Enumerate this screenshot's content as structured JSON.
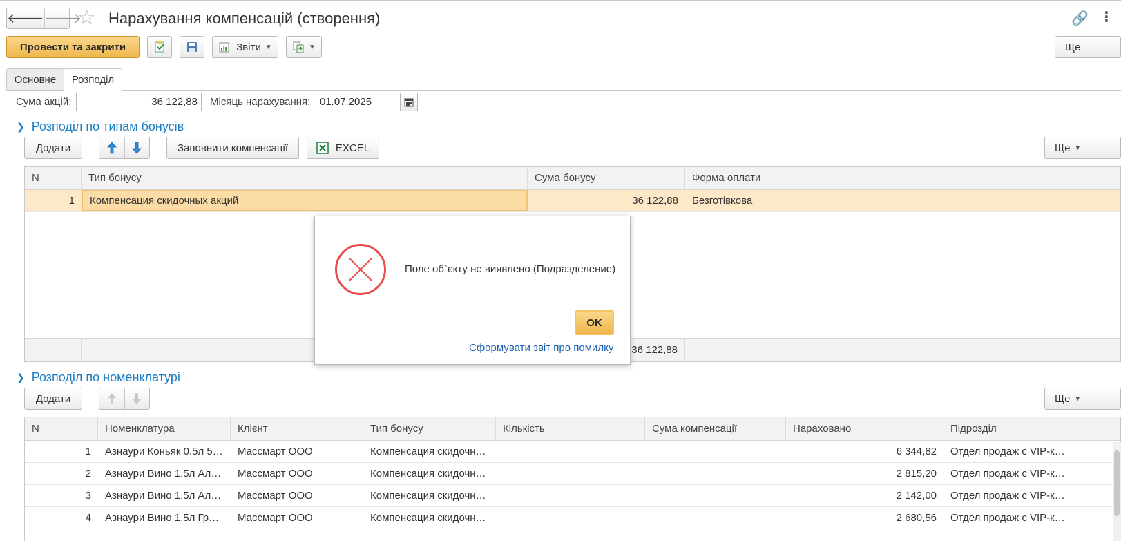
{
  "window": {
    "title": "Нарахування компенсацій (створення)"
  },
  "toolbar": {
    "post_close_label": "Провести та закрити",
    "reports_label": "Звіти",
    "more_label": "Ще"
  },
  "tabs": [
    {
      "label": "Основне",
      "active": false
    },
    {
      "label": "Розподіл",
      "active": true
    }
  ],
  "header_fields": {
    "sum_label": "Сума акцій:",
    "sum_value": "36 122,88",
    "month_label": "Місяць нарахування:",
    "month_value": "01.07.2025"
  },
  "bonus_section": {
    "title": "Розподіл по типам бонусів",
    "add_label": "Додати",
    "fill_label": "Заповнити компенсації",
    "excel_label": "EXCEL",
    "more_label": "Ще",
    "columns": [
      "N",
      "Тип бонусу",
      "Сума бонусу",
      "Форма оплати"
    ],
    "rows": [
      {
        "n": "1",
        "type": "Компенсация скидочных акций",
        "sum": "36 122,88",
        "payment": "Безготівкова"
      }
    ],
    "total_sum": "36 122,88"
  },
  "nomenclature_section": {
    "title": "Розподіл по номенклатурі",
    "add_label": "Додати",
    "more_label": "Ще",
    "columns": [
      "N",
      "Номенклатура",
      "Клієнт",
      "Тип бонусу",
      "Кількість",
      "Сума компенсації",
      "Нараховано",
      "Підрозділ"
    ],
    "rows": [
      {
        "n": "1",
        "item": "Азнаури Коньяк 0.5л 5…",
        "client": "Массмарт ООО",
        "type": "Компенсация скидочн…",
        "qty": "",
        "comp": "",
        "accrued": "6 344,82",
        "dept": "Отдел продаж с  VIP-к…"
      },
      {
        "n": "2",
        "item": "Азнаури Вино 1.5л Ал…",
        "client": "Массмарт ООО",
        "type": "Компенсация скидочн…",
        "qty": "",
        "comp": "",
        "accrued": "2 815,20",
        "dept": "Отдел продаж с  VIP-к…"
      },
      {
        "n": "3",
        "item": "Азнаури Вино 1.5л Ал…",
        "client": "Массмарт ООО",
        "type": "Компенсация скидочн…",
        "qty": "",
        "comp": "",
        "accrued": "2 142,00",
        "dept": "Отдел продаж с  VIP-к…"
      },
      {
        "n": "4",
        "item": "Азнаури Вино 1.5л Гр…",
        "client": "Массмарт ООО",
        "type": "Компенсация скидочн…",
        "qty": "",
        "comp": "",
        "accrued": "2 680,56",
        "dept": "Отдел продаж с  VIP-к…"
      }
    ]
  },
  "dialog": {
    "message": "Поле об`єкту не виявлено (Подразделение)",
    "ok_label": "OK",
    "report_link": "Сформувати звіт про помилку"
  },
  "colors": {
    "accent_blue": "#1b7dc2",
    "primary_button": "#eeb64c",
    "selected_row": "#fde9c8",
    "error_red": "#e84c4c"
  }
}
